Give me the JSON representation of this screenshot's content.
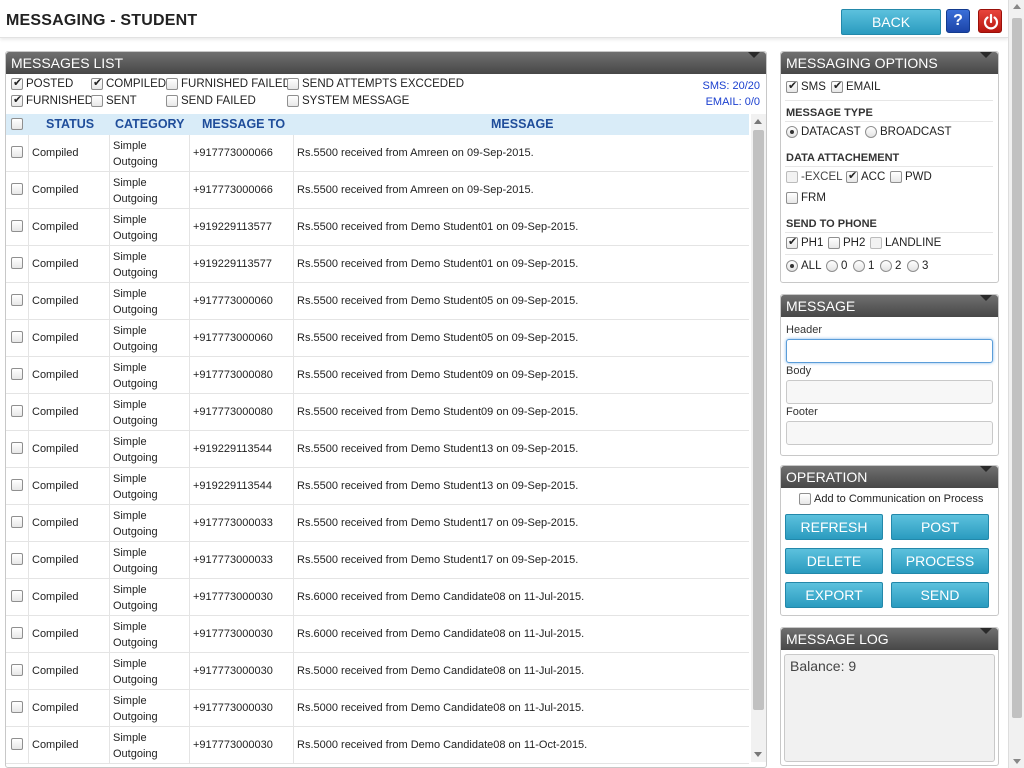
{
  "header": {
    "title": "MESSAGING - STUDENT",
    "back_label": "BACK",
    "help_label": "?"
  },
  "messages_list": {
    "title": "MESSAGES LIST",
    "filters": {
      "posted": {
        "label": "POSTED",
        "checked": true
      },
      "compiled": {
        "label": "COMPILED",
        "checked": true
      },
      "furnished_failed": {
        "label": "FURNISHED FAILED",
        "checked": false
      },
      "send_attempts_exceeded": {
        "label": "SEND ATTEMPTS EXCCEDED",
        "checked": false
      },
      "furnished": {
        "label": "FURNISHED",
        "checked": true
      },
      "sent": {
        "label": "SENT",
        "checked": false
      },
      "send_failed": {
        "label": "SEND FAILED",
        "checked": false
      },
      "system_message": {
        "label": "SYSTEM MESSAGE",
        "checked": false
      }
    },
    "sms_count": "SMS: 20/20",
    "email_count": "EMAIL: 0/0",
    "columns": {
      "status": "STATUS",
      "category": "CATEGORY",
      "message_to": "MESSAGE TO",
      "message": "MESSAGE"
    },
    "rows": [
      {
        "status": "Compiled",
        "category_line1": "Simple",
        "category_line2": "Outgoing",
        "to": "+917773000066",
        "message": "Rs.5500 received from Amreen on 09-Sep-2015."
      },
      {
        "status": "Compiled",
        "category_line1": "Simple",
        "category_line2": "Outgoing",
        "to": "+917773000066",
        "message": "Rs.5500 received from Amreen on 09-Sep-2015."
      },
      {
        "status": "Compiled",
        "category_line1": "Simple",
        "category_line2": "Outgoing",
        "to": "+919229113577",
        "message": "Rs.5500 received from Demo Student01 on 09-Sep-2015."
      },
      {
        "status": "Compiled",
        "category_line1": "Simple",
        "category_line2": "Outgoing",
        "to": "+919229113577",
        "message": "Rs.5500 received from Demo Student01 on 09-Sep-2015."
      },
      {
        "status": "Compiled",
        "category_line1": "Simple",
        "category_line2": "Outgoing",
        "to": "+917773000060",
        "message": "Rs.5500 received from Demo Student05 on 09-Sep-2015."
      },
      {
        "status": "Compiled",
        "category_line1": "Simple",
        "category_line2": "Outgoing",
        "to": "+917773000060",
        "message": "Rs.5500 received from Demo Student05 on 09-Sep-2015."
      },
      {
        "status": "Compiled",
        "category_line1": "Simple",
        "category_line2": "Outgoing",
        "to": "+917773000080",
        "message": "Rs.5500 received from Demo Student09 on 09-Sep-2015."
      },
      {
        "status": "Compiled",
        "category_line1": "Simple",
        "category_line2": "Outgoing",
        "to": "+917773000080",
        "message": "Rs.5500 received from Demo Student09 on 09-Sep-2015."
      },
      {
        "status": "Compiled",
        "category_line1": "Simple",
        "category_line2": "Outgoing",
        "to": "+919229113544",
        "message": "Rs.5500 received from Demo Student13 on 09-Sep-2015."
      },
      {
        "status": "Compiled",
        "category_line1": "Simple",
        "category_line2": "Outgoing",
        "to": "+919229113544",
        "message": "Rs.5500 received from Demo Student13 on 09-Sep-2015."
      },
      {
        "status": "Compiled",
        "category_line1": "Simple",
        "category_line2": "Outgoing",
        "to": "+917773000033",
        "message": "Rs.5500 received from Demo Student17 on 09-Sep-2015."
      },
      {
        "status": "Compiled",
        "category_line1": "Simple",
        "category_line2": "Outgoing",
        "to": "+917773000033",
        "message": "Rs.5500 received from Demo Student17 on 09-Sep-2015."
      },
      {
        "status": "Compiled",
        "category_line1": "Simple",
        "category_line2": "Outgoing",
        "to": "+917773000030",
        "message": "Rs.6000 received from Demo Candidate08 on 11-Jul-2015."
      },
      {
        "status": "Compiled",
        "category_line1": "Simple",
        "category_line2": "Outgoing",
        "to": "+917773000030",
        "message": "Rs.6000 received from Demo Candidate08 on 11-Jul-2015."
      },
      {
        "status": "Compiled",
        "category_line1": "Simple",
        "category_line2": "Outgoing",
        "to": "+917773000030",
        "message": "Rs.5000 received from Demo Candidate08 on 11-Jul-2015."
      },
      {
        "status": "Compiled",
        "category_line1": "Simple",
        "category_line2": "Outgoing",
        "to": "+917773000030",
        "message": "Rs.5000 received from Demo Candidate08 on 11-Jul-2015."
      },
      {
        "status": "Compiled",
        "category_line1": "Simple",
        "category_line2": "Outgoing",
        "to": "+917773000030",
        "message": "Rs.5000 received from Demo Candidate08 on 11-Oct-2015."
      }
    ]
  },
  "options": {
    "title": "MESSAGING OPTIONS",
    "sms": {
      "label": "SMS",
      "checked": true
    },
    "email": {
      "label": "EMAIL",
      "checked": true
    },
    "message_type_label": "MESSAGE TYPE",
    "datacast": {
      "label": "DATACAST",
      "selected": true
    },
    "broadcast": {
      "label": "BROADCAST",
      "selected": false
    },
    "data_attachment_label": "DATA ATTACHEMENT",
    "excel": {
      "label": "-EXCEL",
      "checked": false
    },
    "acc": {
      "label": "ACC",
      "checked": true
    },
    "pwd": {
      "label": "PWD",
      "checked": false
    },
    "frm": {
      "label": "FRM",
      "checked": false
    },
    "send_to_phone_label": "SEND TO PHONE",
    "ph1": {
      "label": "PH1",
      "checked": true
    },
    "ph2": {
      "label": "PH2",
      "checked": false
    },
    "landline": {
      "label": "LANDLINE",
      "checked": false
    },
    "phone_select": [
      {
        "label": "ALL",
        "selected": true
      },
      {
        "label": "0",
        "selected": false
      },
      {
        "label": "1",
        "selected": false
      },
      {
        "label": "2",
        "selected": false
      },
      {
        "label": "3",
        "selected": false
      }
    ]
  },
  "message": {
    "title": "MESSAGE",
    "header_label": "Header",
    "header_value": "",
    "body_label": "Body",
    "body_value": "",
    "footer_label": "Footer",
    "footer_value": ""
  },
  "operation": {
    "title": "OPERATION",
    "add_to_comm_label": "Add to Communication on Process",
    "refresh": "REFRESH",
    "post": "POST",
    "delete": "DELETE",
    "process": "PROCESS",
    "export": "EXPORT",
    "send": "SEND"
  },
  "log": {
    "title": "MESSAGE LOG",
    "text": "Balance: 9"
  },
  "colors": {
    "accent_button": "#2a9bbf",
    "panel_header": "#474747",
    "table_header_bg": "#d9ecf8",
    "table_header_text": "#1f4d9a",
    "counter_text": "#1a3fcf"
  }
}
